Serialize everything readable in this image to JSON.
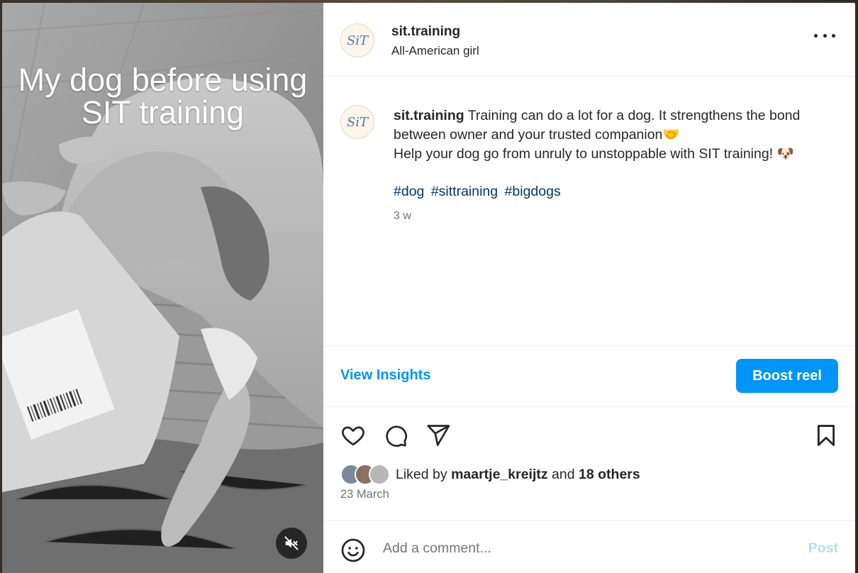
{
  "media": {
    "overlay_caption_line1": "My dog before using",
    "overlay_caption_line2": "SIT training",
    "mute_icon": "speaker-muted-icon"
  },
  "header": {
    "avatar_text": "SiT",
    "username": "sit.training",
    "subtitle": "All-American girl",
    "more_icon": "more-horizontal-icon"
  },
  "caption": {
    "avatar_text": "SiT",
    "username": "sit.training",
    "text_line1": " Training can do a lot for a dog. It strengthens the bond between owner and your trusted companion🤝",
    "text_line2": "Help your dog go from unruly to unstoppable with SIT training! 🐶",
    "hashtags": [
      "#dog",
      "#sittraining",
      "#bigdogs"
    ],
    "time_ago": "3 w"
  },
  "insights": {
    "view_insights_label": "View Insights",
    "boost_label": "Boost reel"
  },
  "actions": {
    "like_icon": "heart-icon",
    "comment_icon": "comment-icon",
    "share_icon": "send-icon",
    "save_icon": "bookmark-icon",
    "liked_by_prefix": "Liked by ",
    "liked_by_user": "maartje_kreijtz",
    "liked_by_and": " and ",
    "liked_by_others": "18 others",
    "post_date": "23 March"
  },
  "comment": {
    "emoji_icon": "smiley-icon",
    "placeholder": "Add a comment...",
    "post_label": "Post"
  },
  "colors": {
    "accent": "#0095f6",
    "hashtag": "#00376b",
    "muted_text": "#737373",
    "post_disabled": "#b2dffc"
  }
}
